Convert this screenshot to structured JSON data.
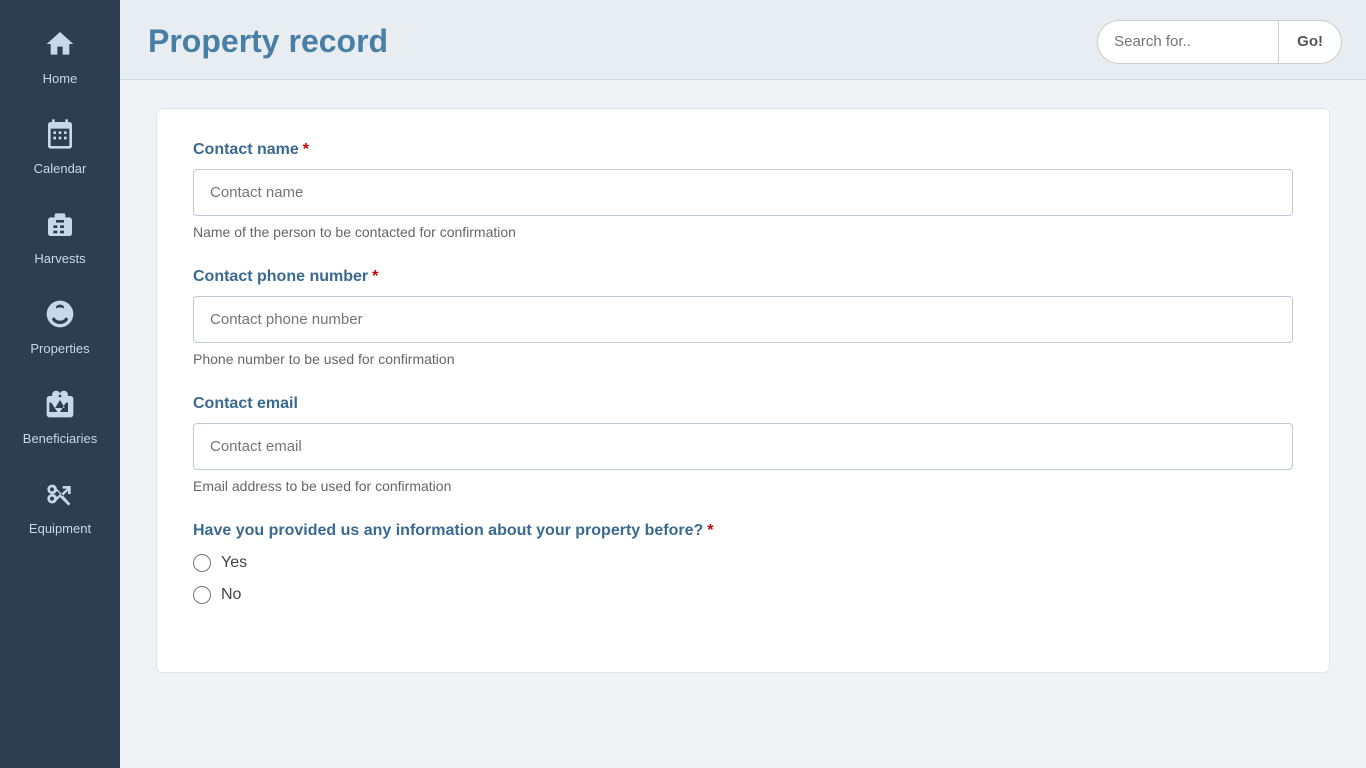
{
  "header": {
    "title": "Property record",
    "search_placeholder": "Search for..",
    "search_button_label": "Go!"
  },
  "sidebar": {
    "items": [
      {
        "id": "home",
        "label": "Home",
        "icon": "home"
      },
      {
        "id": "calendar",
        "label": "Calendar",
        "icon": "calendar"
      },
      {
        "id": "harvests",
        "label": "Harvests",
        "icon": "harvests"
      },
      {
        "id": "properties",
        "label": "Properties",
        "icon": "properties"
      },
      {
        "id": "beneficiaries",
        "label": "Beneficiaries",
        "icon": "beneficiaries"
      },
      {
        "id": "equipment",
        "label": "Equipment",
        "icon": "equipment"
      }
    ]
  },
  "form": {
    "fields": [
      {
        "id": "contact_name",
        "label": "Contact name",
        "required": true,
        "placeholder": "Contact name",
        "hint": "Name of the person to be contacted for confirmation",
        "type": "text"
      },
      {
        "id": "contact_phone",
        "label": "Contact phone number",
        "required": true,
        "placeholder": "Contact phone number",
        "hint": "Phone number to be used for confirmation",
        "type": "text"
      },
      {
        "id": "contact_email",
        "label": "Contact email",
        "required": false,
        "placeholder": "Contact email",
        "hint": "Email address to be used for confirmation",
        "type": "email"
      }
    ],
    "radio_question": "Have you provided us any information about your property before?",
    "radio_required": true,
    "radio_options": [
      {
        "value": "yes",
        "label": "Yes"
      },
      {
        "value": "no",
        "label": "No"
      }
    ]
  }
}
